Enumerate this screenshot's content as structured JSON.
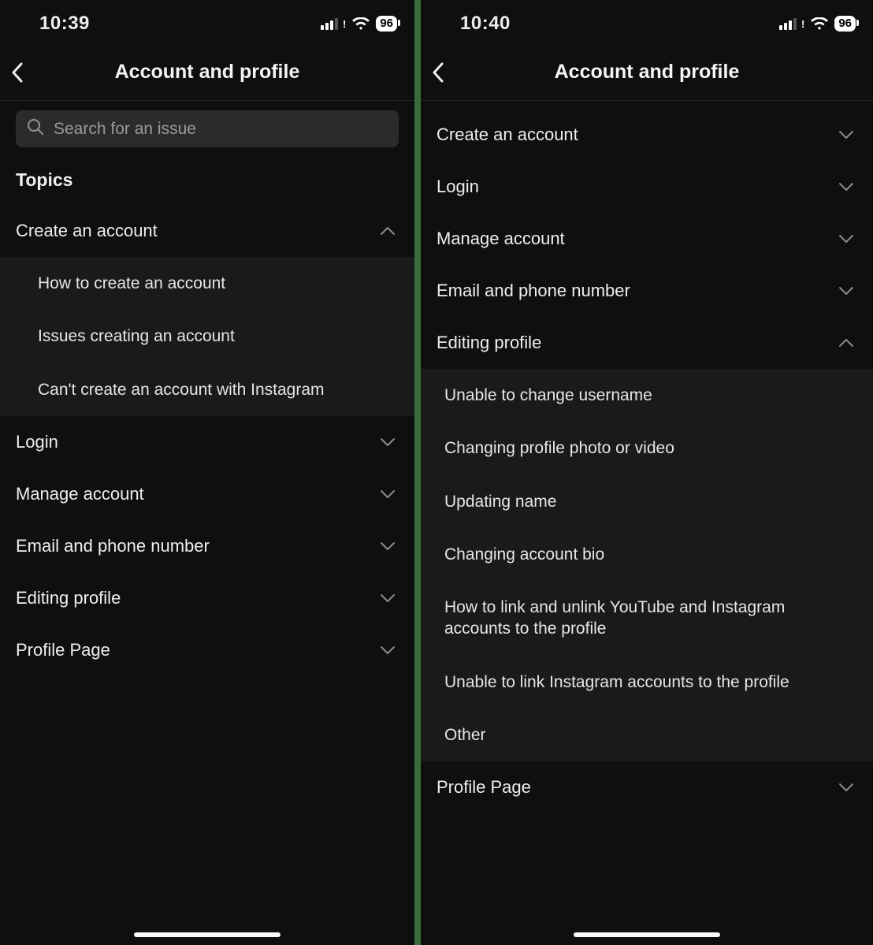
{
  "left": {
    "status": {
      "time": "10:39",
      "battery": "96"
    },
    "nav_title": "Account and profile",
    "search_placeholder": "Search for an issue",
    "section_heading": "Topics",
    "topics": [
      {
        "label": "Create an account",
        "expanded": true,
        "items": [
          "How to create an account",
          "Issues creating an account",
          "Can't create an account with Instagram"
        ]
      },
      {
        "label": "Login",
        "expanded": false
      },
      {
        "label": "Manage account",
        "expanded": false
      },
      {
        "label": "Email and phone number",
        "expanded": false
      },
      {
        "label": "Editing profile",
        "expanded": false
      },
      {
        "label": "Profile Page",
        "expanded": false
      }
    ]
  },
  "right": {
    "status": {
      "time": "10:40",
      "battery": "96"
    },
    "nav_title": "Account and profile",
    "topics": [
      {
        "label": "Create an account",
        "expanded": false
      },
      {
        "label": "Login",
        "expanded": false
      },
      {
        "label": "Manage account",
        "expanded": false
      },
      {
        "label": "Email and phone number",
        "expanded": false
      },
      {
        "label": "Editing profile",
        "expanded": true,
        "items": [
          "Unable to change username",
          "Changing profile photo or video",
          "Updating name",
          "Changing account bio",
          "How to link and unlink YouTube and Instagram accounts to the profile",
          "Unable to link Instagram accounts to the profile",
          "Other"
        ]
      },
      {
        "label": "Profile Page",
        "expanded": false
      }
    ]
  }
}
